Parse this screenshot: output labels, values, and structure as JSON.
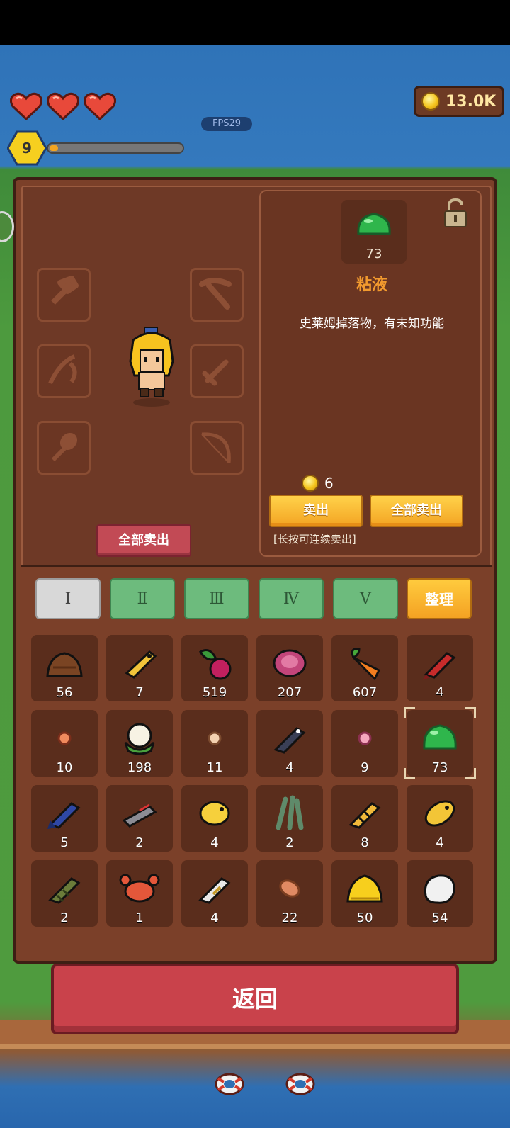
{
  "hud": {
    "hearts": 3,
    "coins": "13.0K",
    "fps": "FPS29",
    "level": "9",
    "xp_fraction": 0.04
  },
  "equipment": {
    "sell_all_label": "全部卖出",
    "slots_left": [
      "axe-slot-icon",
      "fishing-rod-slot-icon",
      "shovel-slot-icon"
    ],
    "slots_right": [
      "pickaxe-slot-icon",
      "sword-slot-icon",
      "bow-slot-icon"
    ]
  },
  "detail": {
    "item_count": "73",
    "item_name": "粘液",
    "item_description": "史莱姆掉落物，有未知功能",
    "price": "6",
    "sell_label": "卖出",
    "sell_all_label": "全部卖出",
    "hint": "[长按可连续卖出]"
  },
  "tabs": {
    "t1": "Ⅰ",
    "t2": "Ⅱ",
    "t3": "Ⅲ",
    "t4": "Ⅳ",
    "t5": "Ⅴ",
    "sort": "整理"
  },
  "inventory": [
    {
      "icon": "dirt-pile-icon",
      "count": "56"
    },
    {
      "icon": "golden-fish-icon",
      "count": "7"
    },
    {
      "icon": "beet-icon",
      "count": "519"
    },
    {
      "icon": "pink-gem-icon",
      "count": "207"
    },
    {
      "icon": "carrot-icon",
      "count": "607"
    },
    {
      "icon": "red-fish-icon",
      "count": "4"
    },
    {
      "icon": "small-orange-seed-icon",
      "count": "10"
    },
    {
      "icon": "cauliflower-icon",
      "count": "198"
    },
    {
      "icon": "small-pale-seed-icon",
      "count": "11"
    },
    {
      "icon": "dark-fish-icon",
      "count": "4"
    },
    {
      "icon": "small-pink-seed-icon",
      "count": "9"
    },
    {
      "icon": "slime-icon",
      "count": "73"
    },
    {
      "icon": "blue-fish-icon",
      "count": "5"
    },
    {
      "icon": "gray-fish-icon",
      "count": "2"
    },
    {
      "icon": "yellow-puffer-fish-icon",
      "count": "4"
    },
    {
      "icon": "seaweed-icon",
      "count": "2"
    },
    {
      "icon": "striped-fish-icon",
      "count": "8"
    },
    {
      "icon": "gold-fish-icon",
      "count": "4"
    },
    {
      "icon": "green-fish-icon",
      "count": "2"
    },
    {
      "icon": "crab-icon",
      "count": "1"
    },
    {
      "icon": "white-fish-icon",
      "count": "4"
    },
    {
      "icon": "bean-icon",
      "count": "22"
    },
    {
      "icon": "gold-pile-icon",
      "count": "50"
    },
    {
      "icon": "white-stone-icon",
      "count": "54"
    }
  ],
  "back_label": "返回"
}
